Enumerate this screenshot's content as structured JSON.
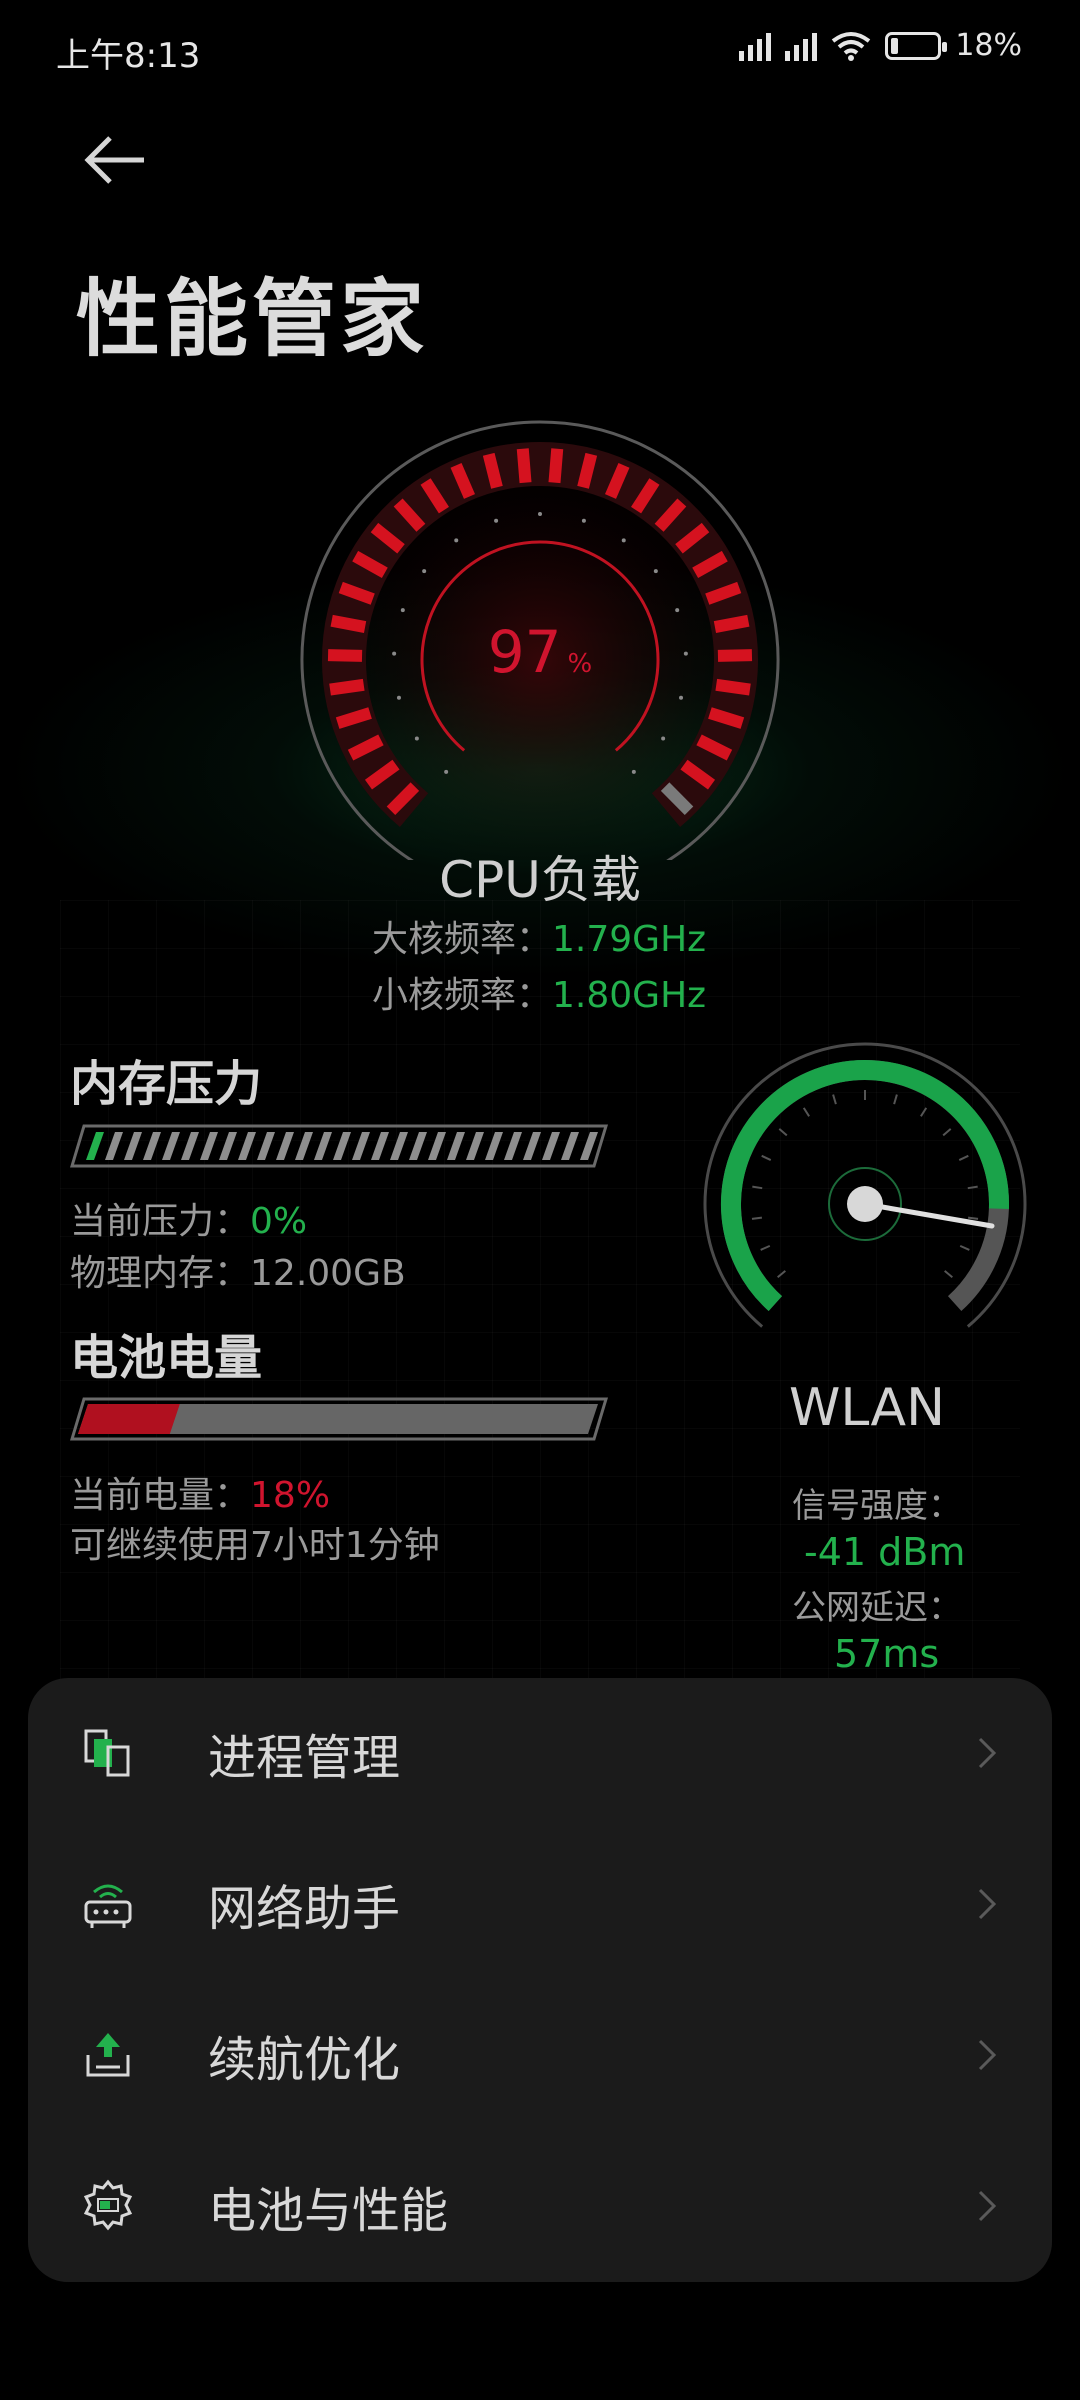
{
  "status_bar": {
    "time": "上午8:13",
    "battery": "18%"
  },
  "header": {
    "title": "性能管家"
  },
  "cpu": {
    "load_value": "97",
    "load_unit": "%",
    "load_fraction": 0.97,
    "title": "CPU负载",
    "big_core_label": "大核频率：",
    "big_core_value": "1.79GHz",
    "small_core_label": "小核频率：",
    "small_core_value": "1.80GHz"
  },
  "memory": {
    "title": "内存压力",
    "pressure_label": "当前压力：",
    "pressure_value": "0%",
    "pressure_fraction": 0.0,
    "physical_label": "物理内存：",
    "physical_value": "12.00GB"
  },
  "battery": {
    "title": "电池电量",
    "level_label": "当前电量：",
    "level_value": "18%",
    "level_fraction": 0.18,
    "remaining": "可继续使用7小时1分钟"
  },
  "wlan": {
    "title": "WLAN",
    "signal_label": "信号强度：",
    "signal_value": "-41 dBm",
    "latency_label": "公网延迟：",
    "latency_value": "57ms"
  },
  "menu": {
    "items": [
      {
        "label": "进程管理",
        "icon": "process-icon"
      },
      {
        "label": "网络助手",
        "icon": "router-icon"
      },
      {
        "label": "续航优化",
        "icon": "battery-upload-icon"
      },
      {
        "label": "电池与性能",
        "icon": "battery-gear-icon"
      }
    ]
  },
  "colors": {
    "accent_green": "#23b14d",
    "accent_red": "#d0142e",
    "background": "#000000",
    "card": "#1b1b1b"
  }
}
